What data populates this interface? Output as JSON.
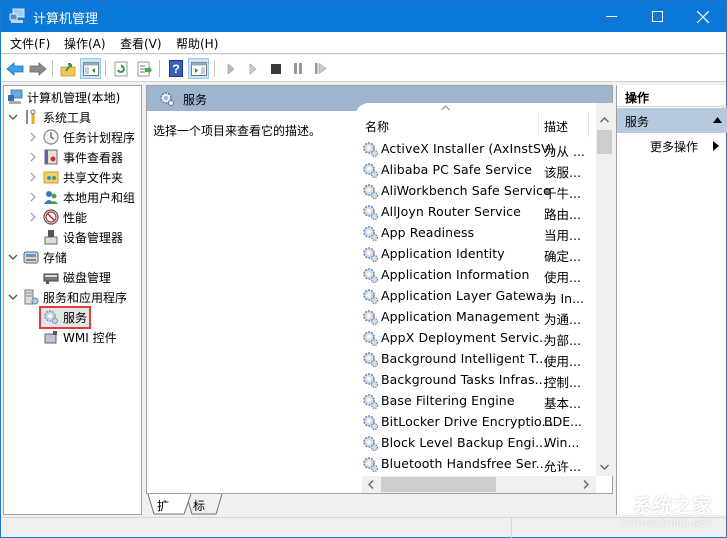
{
  "window": {
    "title": "计算机管理",
    "controls": {
      "minimize": "minimize",
      "maximize": "maximize",
      "close": "close"
    }
  },
  "menu": {
    "items": [
      {
        "label": "文件(F)"
      },
      {
        "label": "操作(A)"
      },
      {
        "label": "查看(V)"
      },
      {
        "label": "帮助(H)"
      }
    ]
  },
  "toolbar": {
    "buttons": [
      {
        "icon": "back-arrow-icon"
      },
      {
        "icon": "forward-arrow-icon"
      },
      {
        "icon": "up-folder-icon"
      },
      {
        "icon": "show-hide-console-tree-icon",
        "pressed": true
      },
      {
        "icon": "refresh-icon"
      },
      {
        "icon": "export-list-icon"
      },
      {
        "icon": "help-icon"
      },
      {
        "icon": "show-hide-action-pane-icon",
        "pressed": true
      },
      {
        "icon": "start-service-icon"
      },
      {
        "icon": "start-service-alt-icon"
      },
      {
        "icon": "stop-service-icon"
      },
      {
        "icon": "pause-service-icon"
      },
      {
        "icon": "resume-service-icon"
      }
    ]
  },
  "tree": {
    "root": {
      "label": "计算机管理(本地)"
    },
    "items": [
      {
        "label": "系统工具",
        "level": 1,
        "expanded": true
      },
      {
        "label": "任务计划程序",
        "level": 2,
        "collapsed": true
      },
      {
        "label": "事件查看器",
        "level": 2,
        "collapsed": true
      },
      {
        "label": "共享文件夹",
        "level": 2,
        "collapsed": true
      },
      {
        "label": "本地用户和组",
        "level": 2,
        "collapsed": true
      },
      {
        "label": "性能",
        "level": 2,
        "collapsed": true
      },
      {
        "label": "设备管理器",
        "level": 2
      },
      {
        "label": "存储",
        "level": 1,
        "expanded": true
      },
      {
        "label": "磁盘管理",
        "level": 2
      },
      {
        "label": "服务和应用程序",
        "level": 1,
        "expanded": true
      },
      {
        "label": "服务",
        "level": 2,
        "selected": true
      },
      {
        "label": "WMI 控件",
        "level": 2
      }
    ]
  },
  "center": {
    "header_title": "服务",
    "description_hint": "选择一个项目来查看它的描述。",
    "columns": {
      "name": "名称",
      "description": "描述"
    },
    "services": [
      {
        "name": "ActiveX Installer (AxInstSV)",
        "description": "为从 ..."
      },
      {
        "name": "Alibaba PC Safe Service",
        "description": "该服..."
      },
      {
        "name": "AliWorkbench Safe Service",
        "description": "千牛..."
      },
      {
        "name": "AllJoyn Router Service",
        "description": "路由..."
      },
      {
        "name": "App Readiness",
        "description": "当用..."
      },
      {
        "name": "Application Identity",
        "description": "确定..."
      },
      {
        "name": "Application Information",
        "description": "使用..."
      },
      {
        "name": "Application Layer Gatewa...",
        "description": "为 In..."
      },
      {
        "name": "Application Management",
        "description": "为通..."
      },
      {
        "name": "AppX Deployment Servic...",
        "description": "为部..."
      },
      {
        "name": "Background Intelligent T...",
        "description": "使用..."
      },
      {
        "name": "Background Tasks Infras...",
        "description": "控制..."
      },
      {
        "name": "Base Filtering Engine",
        "description": "基本..."
      },
      {
        "name": "BitLocker Drive Encryptio...",
        "description": "BDE..."
      },
      {
        "name": "Block Level Backup Engi...",
        "description": "Win..."
      },
      {
        "name": "Bluetooth Handsfree Ser...",
        "description": "允许..."
      }
    ],
    "tabs": [
      {
        "label": "扩展",
        "active": true
      },
      {
        "label": "标准",
        "active": false
      }
    ]
  },
  "actions": {
    "title": "操作",
    "group_label": "服务",
    "more_actions": "更多操作"
  },
  "watermark": {
    "text_cn": "系统之家",
    "text_en": "XITONGZHIJIA.NET"
  }
}
